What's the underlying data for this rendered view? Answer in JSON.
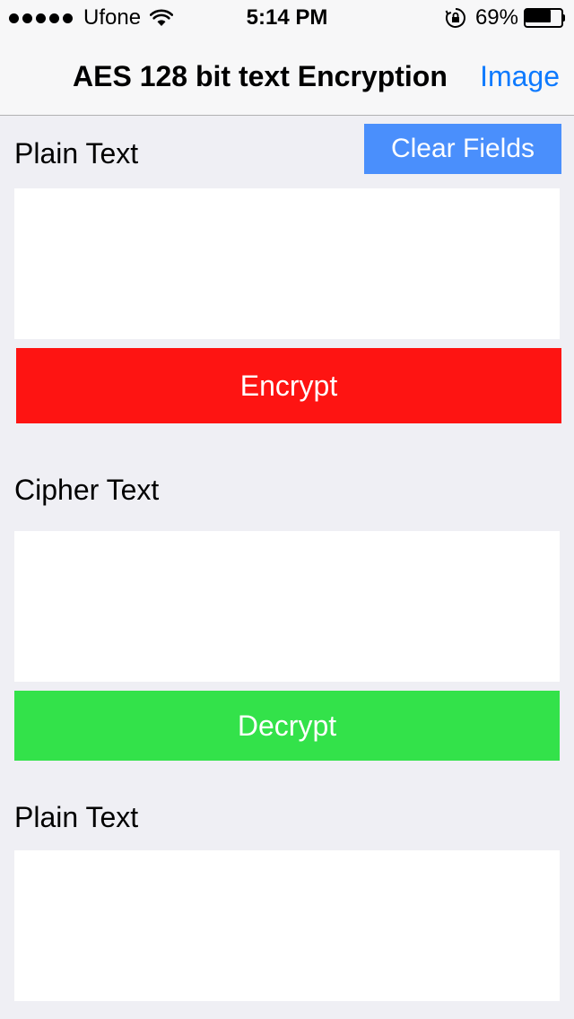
{
  "status_bar": {
    "carrier": "Ufone",
    "time": "5:14 PM",
    "battery_percent": "69%",
    "battery_level": 0.69,
    "signal_bars": 5,
    "icons": [
      "signal-dots-icon",
      "wifi-icon",
      "rotation-lock-icon",
      "battery-icon"
    ]
  },
  "nav_bar": {
    "title": "AES 128 bit text Encryption",
    "right_button": "Image"
  },
  "main": {
    "plain_text_label": "Plain Text",
    "clear_fields_label": "Clear Fields",
    "plain_text_value": "",
    "encrypt_label": "Encrypt",
    "cipher_text_label": "Cipher Text",
    "cipher_text_value": "",
    "decrypt_label": "Decrypt",
    "decrypted_text_label": "Plain Text",
    "decrypted_text_value": ""
  },
  "colors": {
    "background": "#efeff4",
    "nav_tint": "#0e7afe",
    "clear_button": "#4a8ffc",
    "encrypt_button": "#fe1412",
    "decrypt_button": "#33e24a"
  }
}
